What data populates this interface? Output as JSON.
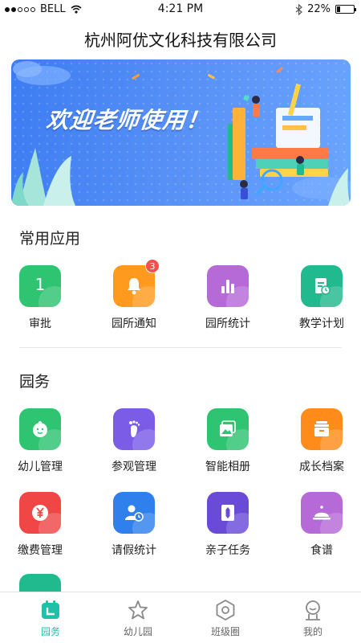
{
  "status_bar": {
    "carrier": "BELL",
    "time": "4:21 PM",
    "battery": "22%",
    "battery_level": 0.22
  },
  "header": {
    "title": "杭州阿优文化科技有限公司"
  },
  "banner": {
    "text": "欢迎老师使用！"
  },
  "common": {
    "title": "常用应用",
    "apps": [
      {
        "label": "审批",
        "icon": "number-one-icon",
        "color": "#2ec471",
        "value": "1"
      },
      {
        "label": "园所通知",
        "icon": "bell-icon",
        "color": "#ff9a1f",
        "badge": "3"
      },
      {
        "label": "园所统计",
        "icon": "bar-chart-icon",
        "color": "#b56ad8"
      },
      {
        "label": "教学计划",
        "icon": "document-clock-icon",
        "color": "#21b98e"
      }
    ]
  },
  "garden": {
    "title": "园务",
    "apps": [
      {
        "label": "幼儿管理",
        "icon": "baby-face-icon",
        "color": "#2ec471"
      },
      {
        "label": "参观管理",
        "icon": "footprint-icon",
        "color": "#7b5ce7"
      },
      {
        "label": "智能相册",
        "icon": "photo-album-icon",
        "color": "#2ec471"
      },
      {
        "label": "成长档案",
        "icon": "archive-box-icon",
        "color": "#ff8c1a"
      },
      {
        "label": "缴费管理",
        "icon": "yuan-coin-icon",
        "color": "#f04646"
      },
      {
        "label": "请假统计",
        "icon": "person-clock-icon",
        "color": "#2f80ed"
      },
      {
        "label": "亲子任务",
        "icon": "pencil-icon",
        "color": "#6a4bd8"
      },
      {
        "label": "食谱",
        "icon": "food-dome-icon",
        "color": "#b56ad8"
      },
      {
        "label": "",
        "icon": "partial-app-icon",
        "color": "#21b98e"
      }
    ]
  },
  "tabs": [
    {
      "label": "园务",
      "icon": "calendar-icon",
      "active": true
    },
    {
      "label": "幼儿园",
      "icon": "star-icon",
      "active": false
    },
    {
      "label": "班级圈",
      "icon": "hexagon-icon",
      "active": false
    },
    {
      "label": "我的",
      "icon": "user-icon",
      "active": false
    }
  ],
  "colors": {
    "accent": "#1fc0a8",
    "banner": "#4a86f4"
  }
}
